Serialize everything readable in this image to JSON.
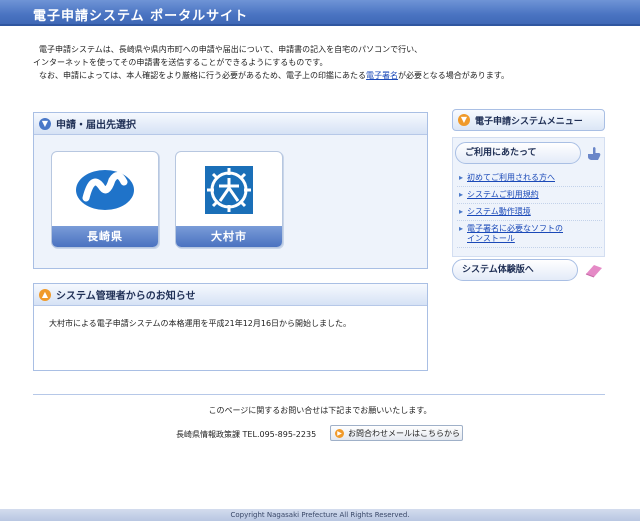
{
  "header": {
    "title": "電子申請システム ポータルサイト"
  },
  "intro": {
    "line1": "電子申請システムは、長崎県や県内市町への申請や届出について、申請書の記入を自宅のパソコンで行い、",
    "line2": "インターネットを使ってその申請書を送信することができるようにするものです。",
    "line3_pre": "なお、申請によっては、本人確認をより厳格に行う必要があるため、電子上の印鑑にあたる",
    "line3_link": "電子署名",
    "line3_post": "が必要となる場合があります。"
  },
  "select_panel": {
    "title": "申請・届出先選択",
    "tiles": [
      {
        "label": "長崎県",
        "icon": "nagasaki-logo-icon",
        "color": "#1f73c9"
      },
      {
        "label": "大村市",
        "icon": "omura-emblem-icon",
        "color": "#1a6fb8"
      }
    ]
  },
  "notice_panel": {
    "title": "システム管理者からのお知らせ",
    "text": "大村市による電子申請システムの本格運用を平成21年12月16日から開始しました。"
  },
  "sidebar": {
    "menu_title": "電子申請システムメニュー",
    "usage_title": "ご利用にあたって",
    "links": [
      {
        "label": "初めてご利用される方へ"
      },
      {
        "label": "システムご利用規約"
      },
      {
        "label": "システム動作環境"
      },
      {
        "label": "電子署名に必要なソフトの",
        "label2": "インストール"
      }
    ],
    "trial_label": "システム体験版へ"
  },
  "footer": {
    "note": "このページに関するお問い合せは下記までお願いいたします。",
    "dept": "長崎県情報政策課 TEL.095-895-2235",
    "contact_button": "お問合わせメールはこちらから",
    "copyright": "Copyright Nagasaki Prefecture All Rights Reserved."
  }
}
